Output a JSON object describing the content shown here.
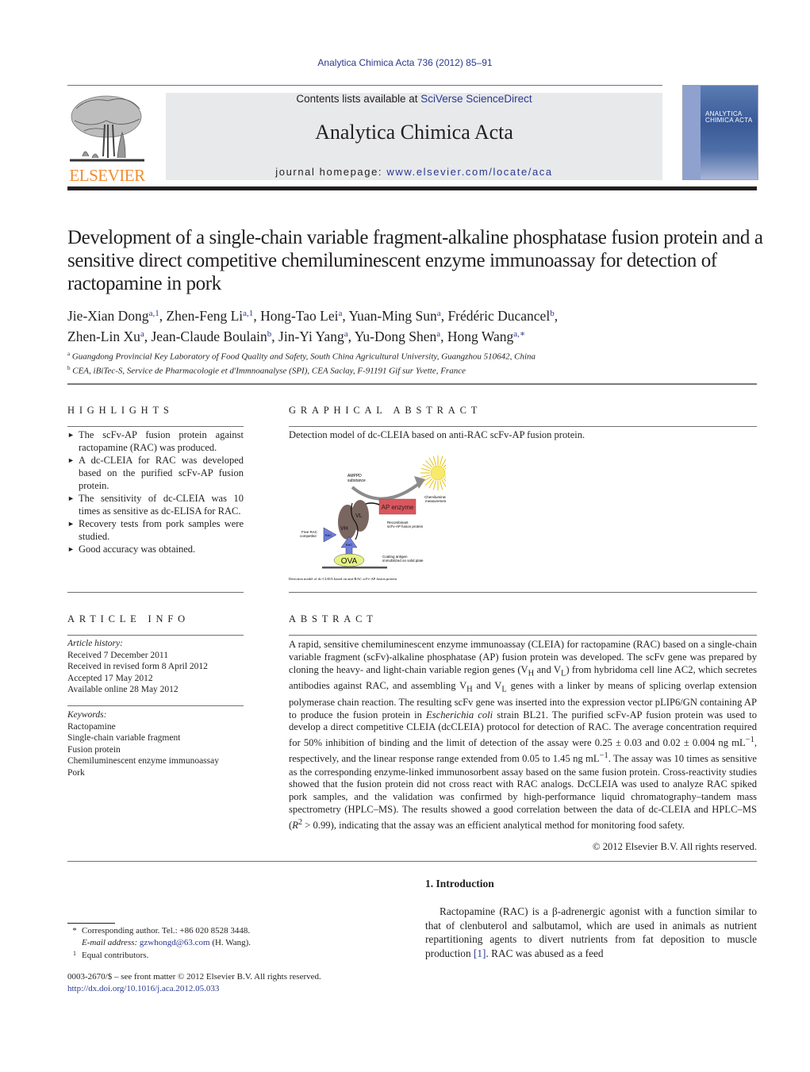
{
  "header": {
    "journal_ref": "Analytica Chimica Acta 736 (2012) 85–91",
    "contents_prefix": "Contents lists available at ",
    "contents_link": "SciVerse ScienceDirect",
    "journal_title": "Analytica Chimica Acta",
    "homepage_prefix": "journal homepage: ",
    "homepage_link": "www.elsevier.com/locate/aca",
    "publisher_logo_text": "ELSEVIER",
    "cover_title_line1": "ANALYTICA",
    "cover_title_line2": "CHIMICA ACTA",
    "colors": {
      "link": "#2a3990",
      "logo": "#f08c2d",
      "masthead_bg": "#e8e9eb"
    }
  },
  "article": {
    "title": "Development of a single-chain variable fragment-alkaline phosphatase fusion protein and a sensitive direct competitive chemiluminescent enzyme immunoassay for detection of ractopamine in pork",
    "authors": [
      {
        "name": "Jie-Xian Dong",
        "sup": "a,1",
        "sep": ", "
      },
      {
        "name": "Zhen-Feng Li",
        "sup": "a,1",
        "sep": ", "
      },
      {
        "name": "Hong-Tao Lei",
        "sup": "a",
        "sep": ", "
      },
      {
        "name": "Yuan-Ming Sun",
        "sup": "a",
        "sep": ", "
      },
      {
        "name": "Frédéric Ducancel",
        "sup": "b",
        "sep": ", "
      },
      {
        "name": "Zhen-Lin Xu",
        "sup": "a",
        "sep": ", "
      },
      {
        "name": "Jean-Claude Boulain",
        "sup": "b",
        "sep": ", "
      },
      {
        "name": "Jin-Yi Yang",
        "sup": "a",
        "sep": ", "
      },
      {
        "name": "Yu-Dong Shen",
        "sup": "a",
        "sep": ", "
      },
      {
        "name": "Hong Wang",
        "sup": "a,∗",
        "sep": ""
      }
    ],
    "affiliations": [
      {
        "mark": "a",
        "text": "Guangdong Provincial Key Laboratory of Food Quality and Safety, South China Agricultural University, Guangzhou 510642, China"
      },
      {
        "mark": "b",
        "text": "CEA, iBiTec-S, Service de Pharmacologie et d'Immnoanalyse (SPI), CEA Saclay, F-91191 Gif sur Yvette, France"
      }
    ]
  },
  "highlights": {
    "heading": "HIGHLIGHTS",
    "bullet": "►",
    "items": [
      "The scFv-AP fusion protein against ractopamine (RAC) was produced.",
      "A dc-CLEIA for RAC was developed based on the purified scFv-AP fusion protein.",
      "The sensitivity of dc-CLEIA was 10 times as sensitive as dc-ELISA for RAC.",
      "Recovery tests from pork samples were studied.",
      "Good accuracy was obtained."
    ]
  },
  "graphical_abstract": {
    "heading": "GRAPHICAL ABSTRACT",
    "caption": "Detection model of dc-CLEIA based on anti-RAC scFv-AP fusion protein.",
    "figure": {
      "labels": {
        "substrate": [
          "AMPPD",
          "substance"
        ],
        "measurement": [
          "Chemiluminescent",
          "measurement"
        ],
        "enzyme": "AP enzyme",
        "fusion": [
          "Recombinant",
          "scFv-AP fusion protein"
        ],
        "vh": "VH",
        "vl": "VL",
        "free_rac": [
          "Free RAC",
          "competitor"
        ],
        "rac": "RAC",
        "ova": "OVA",
        "coating": [
          "Coating antigen",
          "immobilized on solid plate"
        ]
      },
      "small_caption": "Detection model of dc-CLEIA based on anti-RAC scFv-AP fusion protein"
    }
  },
  "article_info": {
    "heading": "ARTICLE INFO",
    "history_label": "Article history:",
    "history": [
      "Received 7 December 2011",
      "Received in revised form 8 April 2012",
      "Accepted 17 May 2012",
      "Available online 28 May 2012"
    ],
    "keywords_label": "Keywords:",
    "keywords": [
      "Ractopamine",
      "Single-chain variable fragment",
      "Fusion protein",
      "Chemiluminescent enzyme immunoassay",
      "Pork"
    ]
  },
  "abstract": {
    "heading": "ABSTRACT",
    "p1": "A rapid, sensitive chemiluminescent enzyme immunoassay (CLEIA) for ractopamine (RAC) based on a single-chain variable fragment (scFv)-alkaline phosphatase (AP) fusion protein was developed. The scFv gene was prepared by cloning the heavy- and light-chain variable region genes (V",
    "sub_h": "H",
    "and1": " and V",
    "sub_l": "L",
    "p2": ") from hybridoma cell line AC2, which secretes antibodies against RAC, and assembling V",
    "and2": " and V",
    "p3": " genes with a linker by means of splicing overlap extension polymerase chain reaction. The resulting scFv gene was inserted into the expression vector pLIP6/GN containing AP to produce the fusion protein in ",
    "species": "Escherichia coli",
    "p4": " strain BL21. The purified scFv-AP fusion protein was used to develop a direct competitive CLEIA (dcCLEIA) protocol for detection of RAC. The average concentration required for 50% inhibition of binding and the limit of detection of the assay were 0.25 ± 0.03 and 0.02 ± 0.004 ng mL",
    "sup_neg1": "−1",
    "p5": ", respectively, and the linear response range extended from 0.05 to 1.45 ng mL",
    "p6": ". The assay was 10 times as sensitive as the corresponding enzyme-linked immunosorbent assay based on the same fusion protein. Cross-reactivity studies showed that the fusion protein did not cross react with RAC analogs. DcCLEIA was used to analyze RAC spiked pork samples, and the validation was confirmed by high-performance liquid chromatography–tandem mass spectrometry (HPLC–MS). The results showed a good correlation between the data of dc-CLEIA and HPLC–MS (",
    "r": "R",
    "r_sup": "2",
    "p7": " > 0.99), indicating that the assay was an efficient analytical method for monitoring food safety.",
    "copyright": "© 2012 Elsevier B.V. All rights reserved."
  },
  "introduction": {
    "heading": "1.  Introduction",
    "text_before_ref": "Ractopamine (RAC) is a β-adrenergic agonist with a function similar to that of clenbuterol and salbutamol, which are used in animals as nutrient repartitioning agents to divert nutrients from fat deposition to muscle production ",
    "ref": "[1]",
    "text_after_ref": ". RAC was abused as a feed"
  },
  "footnotes": {
    "corr_mark": "*",
    "corr_text": "Corresponding author. Tel.: +86 020 8528 3448.",
    "email_label": "E-mail address: ",
    "email": "gzwhongd@63.com",
    "email_suffix": " (H. Wang).",
    "equal_mark": "1",
    "equal_text": "Equal contributors.",
    "issn": "0003-2670/$ – see front matter © 2012 Elsevier B.V. All rights reserved.",
    "doi": "http://dx.doi.org/10.1016/j.aca.2012.05.033"
  }
}
